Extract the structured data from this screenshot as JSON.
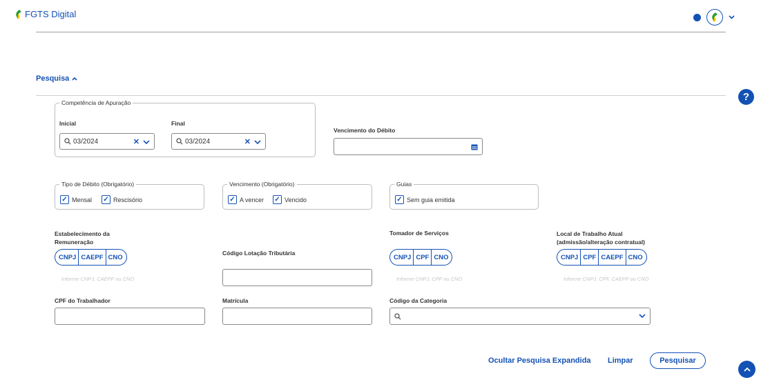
{
  "header": {
    "app_title": "FGTS Digital",
    "avatar_chevron": "⌄"
  },
  "search": {
    "title": "Pesquisa",
    "toggle_icon": "^",
    "help": "?"
  },
  "competencia": {
    "legend": "Competência de Apuração",
    "inicial_label": "Inicial",
    "inicial_value": "03/2024",
    "final_label": "Final",
    "final_value": "03/2024"
  },
  "vencimento_debito": {
    "label": "Vencimento do Débito",
    "value": ""
  },
  "tipo_debito": {
    "legend": "Tipo de Débito (Obrigatório)",
    "options": [
      {
        "label": "Mensal",
        "checked": true
      },
      {
        "label": "Rescisório",
        "checked": true
      }
    ]
  },
  "vencimento": {
    "legend": "Vencimento (Obrigatório)",
    "options": [
      {
        "label": "A vencer",
        "checked": true
      },
      {
        "label": "Vencido",
        "checked": true
      }
    ]
  },
  "guias": {
    "legend": "Guias",
    "options": [
      {
        "label": "Sem guia emitida",
        "checked": true
      }
    ]
  },
  "estabelecimento": {
    "label_line1": "Estabelecimento da",
    "label_line2": "Remuneração",
    "segments": [
      "CNPJ",
      "CAEPF",
      "CNO"
    ],
    "hint": "Informe CNPJ, CAEPF ou CNO"
  },
  "lotacao": {
    "label": "Código Lotação Tributária",
    "value": ""
  },
  "tomador": {
    "label": "Tomador de Serviços",
    "segments": [
      "CNPJ",
      "CPF",
      "CNO"
    ],
    "hint": "Informe CNPJ, CPF ou CNO"
  },
  "local_trabalho": {
    "label_line1": "Local de Trabalho Atual",
    "label_line2": "(admissão/alteração contratual)",
    "segments": [
      "CNPJ",
      "CPF",
      "CAEPF",
      "CNO"
    ],
    "hint": "Informe CNPJ, CPF, CAEPF ou CNO"
  },
  "cpf_trabalhador": {
    "label": "CPF do Trabalhador",
    "value": ""
  },
  "matricula": {
    "label": "Matrícula",
    "value": ""
  },
  "categoria": {
    "label": "Código da Categoria",
    "value": ""
  },
  "actions": {
    "toggle_expanded": "Ocultar Pesquisa Expandida",
    "clear": "Limpar",
    "search": "Pesquisar"
  },
  "colors": {
    "primary": "#1351b4",
    "border": "#888888"
  }
}
